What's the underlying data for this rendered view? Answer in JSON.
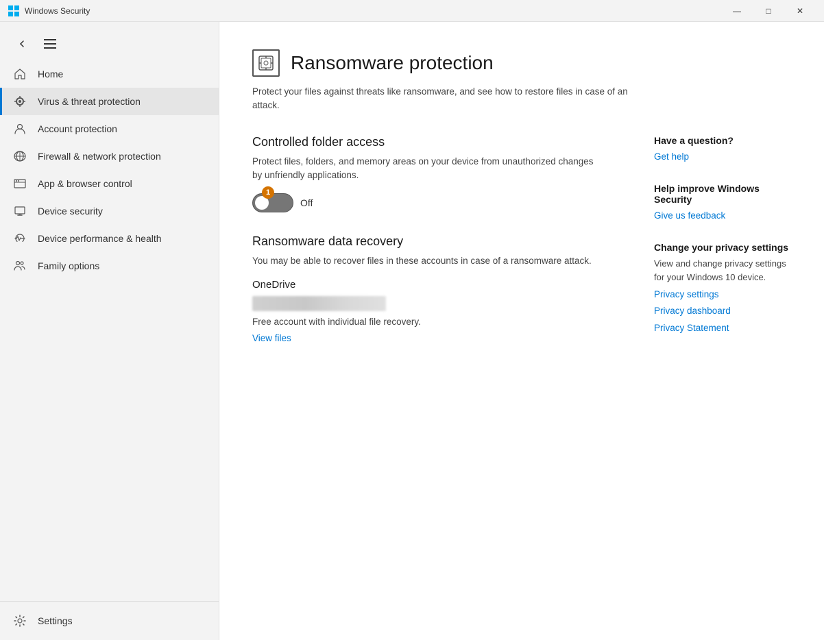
{
  "titlebar": {
    "title": "Windows Security",
    "min_label": "—",
    "max_label": "□",
    "close_label": "✕"
  },
  "sidebar": {
    "hamburger": "☰",
    "back": "←",
    "nav_items": [
      {
        "id": "home",
        "label": "Home",
        "icon": "home"
      },
      {
        "id": "virus",
        "label": "Virus & threat protection",
        "icon": "virus",
        "active": true
      },
      {
        "id": "account",
        "label": "Account protection",
        "icon": "account"
      },
      {
        "id": "firewall",
        "label": "Firewall & network protection",
        "icon": "firewall"
      },
      {
        "id": "browser",
        "label": "App & browser control",
        "icon": "browser"
      },
      {
        "id": "device-security",
        "label": "Device security",
        "icon": "device-security"
      },
      {
        "id": "device-health",
        "label": "Device performance & health",
        "icon": "device-health"
      },
      {
        "id": "family",
        "label": "Family options",
        "icon": "family"
      }
    ],
    "bottom_items": [
      {
        "id": "settings",
        "label": "Settings",
        "icon": "settings"
      }
    ]
  },
  "main": {
    "page_icon": "🔒",
    "page_title": "Ransomware protection",
    "page_subtitle": "Protect your files against threats like ransomware, and see how to restore files in case of an attack.",
    "section1": {
      "title": "Controlled folder access",
      "desc": "Protect files, folders, and memory areas on your device from unauthorized changes by unfriendly applications.",
      "toggle_state": "Off",
      "toggle_badge": "1"
    },
    "section2": {
      "title": "Ransomware data recovery",
      "desc": "You may be able to recover files in these accounts in case of a ransomware attack.",
      "onedrive_title": "OneDrive",
      "onedrive_desc": "Free account with individual file recovery.",
      "view_files_label": "View files"
    }
  },
  "aside": {
    "question_heading": "Have a question?",
    "get_help_label": "Get help",
    "improve_heading": "Help improve Windows Security",
    "feedback_label": "Give us feedback",
    "privacy_heading": "Change your privacy settings",
    "privacy_text": "View and change privacy settings for your Windows 10 device.",
    "privacy_settings_label": "Privacy settings",
    "privacy_dashboard_label": "Privacy dashboard",
    "privacy_statement_label": "Privacy Statement"
  }
}
